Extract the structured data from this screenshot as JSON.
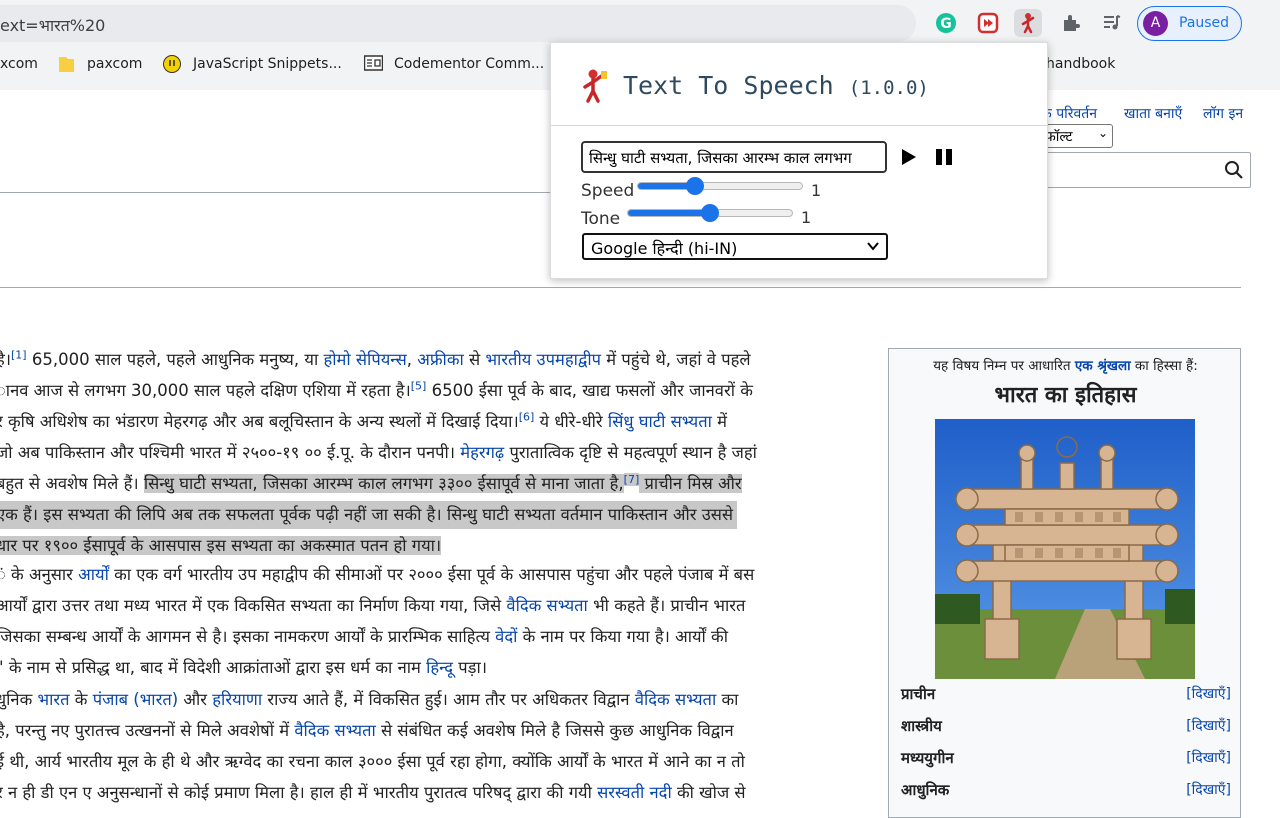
{
  "browser": {
    "url": "ext=भारत%20",
    "profile_initial": "A",
    "profile_status": "Paused",
    "bookmarks": [
      "xcom",
      "paxcom",
      "JavaScript Snippets...",
      "Codementor Comm...",
      "handbook"
    ]
  },
  "wiki": {
    "top_links": [
      "क परिवर्तन",
      "खाता बनाएँ",
      "लॉग इन"
    ],
    "variant_select": "फ़ॉल्ट"
  },
  "article": {
    "p1": [
      [
        "है।",
        "[1]",
        " 65,000 साल पहले, पहले आधुनिक मनुष्य, या ",
        "होमो सेपियन्स",
        ", ",
        "अफ्रीका",
        " से ",
        "भारतीय उपमहाद्वीप",
        " में पहुंचे थे, जहां वे पहले"
      ],
      [
        "ानव आज से लगभग 30,000 साल पहले दक्षिण एशिया में रहता है।",
        "[5]",
        " 6500 ईसा पूर्व के बाद, खाद्य फसलों और जानवरों के"
      ],
      [
        "र कृषि अधिशेष का भंडारण मेहरगढ़ और अब बलूचिस्तान के अन्य स्थलों में दिखाई दिया।",
        "[6]",
        " ये धीरे-धीरे ",
        "सिंधु घाटी सभ्यता",
        " में"
      ],
      [
        "जो अब पाकिस्तान और पश्चिमी भारत में २५००-१९ ०० ई.पू. के दौरान पनपी। ",
        "मेहरगढ़",
        " पुरातात्विक दृष्टि से महत्वपूर्ण स्थान है जहां"
      ],
      [
        "बहुत से अवशेष मिले हैं। ",
        "सिन्धु घाटी सभ्यता, जिसका आरम्भ काल लगभग ३३०० ईसापूर्व से माना जाता है,",
        "[7]",
        " प्राचीन मिस्र और"
      ],
      [
        "एक हैं। इस सभ्यता की लिपि अब तक सफलता पूर्वक पढ़ी नहीं जा सकी है। सिन्धु घाटी सभ्यता वर्तमान पाकिस्तान और उससे"
      ],
      [
        "धार पर १९०० ईसापूर्व के आसपास इस सभ्यता का अकस्मात पतन हो गया।"
      ]
    ],
    "p2": [
      [
        "ं के अनुसार ",
        "आर्यों",
        " का एक वर्ग भारतीय उप महाद्वीप की सीमाओं पर २००० ईसा पूर्व के आसपास पहुंचा और पहले पंजाब में बस"
      ],
      [
        "आर्यों द्वारा उत्तर तथा मध्य भारत में एक विकसित सभ्यता का निर्माण किया गया, जिसे ",
        "वैदिक सभ्यता",
        " भी कहते हैं। प्राचीन भारत"
      ],
      [
        " जिसका सम्बन्ध आर्यों के आगमन से है। इसका नामकरण आर्यों के प्रारम्भिक साहित्य ",
        "वेदों",
        " के नाम पर किया गया है। आर्यों की"
      ],
      [
        "\" के नाम से प्रसिद्ध था, बाद में विदेशी आक्रांताओं द्वारा इस धर्म का नाम ",
        "हिन्दू",
        " पड़ा।"
      ]
    ],
    "p3": [
      [
        "धुनिक ",
        "भारत",
        " के ",
        "पंजाब (भारत)",
        " और ",
        "हरियाणा",
        " राज्य आते हैं, में विकसित हुई। आम तौर पर अधिकतर विद्वान ",
        "वैदिक सभ्यता",
        " का"
      ],
      [
        " है, परन्तु नए पुरातत्त्व उत्खननों से मिले अवशेषों में ",
        "वैदिक सभ्यता",
        " से संबंधित कई अवशेष मिले है जिससे कुछ आधुनिक विद्वान"
      ],
      [
        "ई थी, आर्य भारतीय मूल के ही थे और ऋग्वेद का रचना काल ३००० ईसा पूर्व रहा होगा, क्योंकि आर्यों के भारत में आने का न तो"
      ],
      [
        "र न ही डी एन ए अनुसन्धानों से कोई प्रमाण मिला है। हाल ही में भारतीय पुरातत्व परिषद् द्वारा की गयी ",
        "सरस्वती नदी",
        " की खोज से"
      ]
    ]
  },
  "infobox": {
    "intro_pre": "यह विषय निम्न पर आधारित ",
    "intro_link": "एक श्रृंखला",
    "intro_post": " का हिस्सा हैं:",
    "title": "भारत का इतिहास",
    "rows": [
      {
        "label": "प्राचीन",
        "link": "[दिखाएँ]"
      },
      {
        "label": "शास्त्रीय",
        "link": "[दिखाएँ]"
      },
      {
        "label": "मध्ययुगीन",
        "link": "[दिखाएँ]"
      },
      {
        "label": "आधुनिक",
        "link": "[दिखाएँ]"
      }
    ]
  },
  "popup": {
    "title": "Text To Speech",
    "version": "(1.0.0)",
    "text_value": "सिन्धु घाटी सभ्यता, जिसका आरम्भ काल लगभग",
    "speed_label": "Speed",
    "speed_value": "1",
    "speed_fraction": 0.35,
    "tone_label": "Tone",
    "tone_value": "1",
    "tone_fraction": 0.5,
    "voice": "Google हिन्दी (hi-IN)"
  },
  "colors": {
    "link": "#0645ad",
    "accent": "#1a73e8",
    "highlight": "#c8c8c8",
    "profile": "#7b1fa2"
  }
}
